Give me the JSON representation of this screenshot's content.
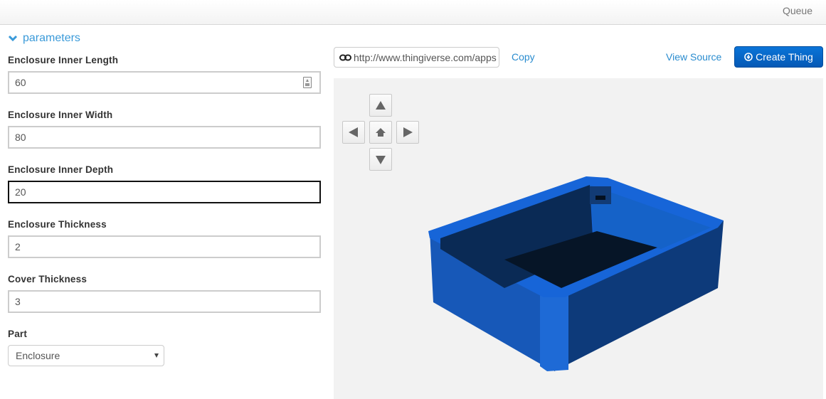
{
  "topbar": {
    "queue_label": "Queue"
  },
  "parameters": {
    "toggle_label": "parameters",
    "fields": [
      {
        "label": "Enclosure Inner Length",
        "value": "60"
      },
      {
        "label": "Enclosure Inner Width",
        "value": "80"
      },
      {
        "label": "Enclosure Inner Depth",
        "value": "20"
      },
      {
        "label": "Enclosure Thickness",
        "value": "2"
      },
      {
        "label": "Cover Thickness",
        "value": "3"
      }
    ],
    "part": {
      "label": "Part",
      "selected": "Enclosure"
    }
  },
  "toolbar": {
    "url_value": "http://www.thingiverse.com/apps",
    "copy_label": "Copy",
    "view_source_label": "View Source",
    "create_label": "Create Thing"
  },
  "viewer": {
    "nav_buttons": [
      "pan-up",
      "pan-left",
      "home",
      "pan-right",
      "pan-down"
    ],
    "model_color": "#1565d8"
  },
  "colors": {
    "link": "#2a8ccf",
    "accent": "#0a6ad0"
  }
}
